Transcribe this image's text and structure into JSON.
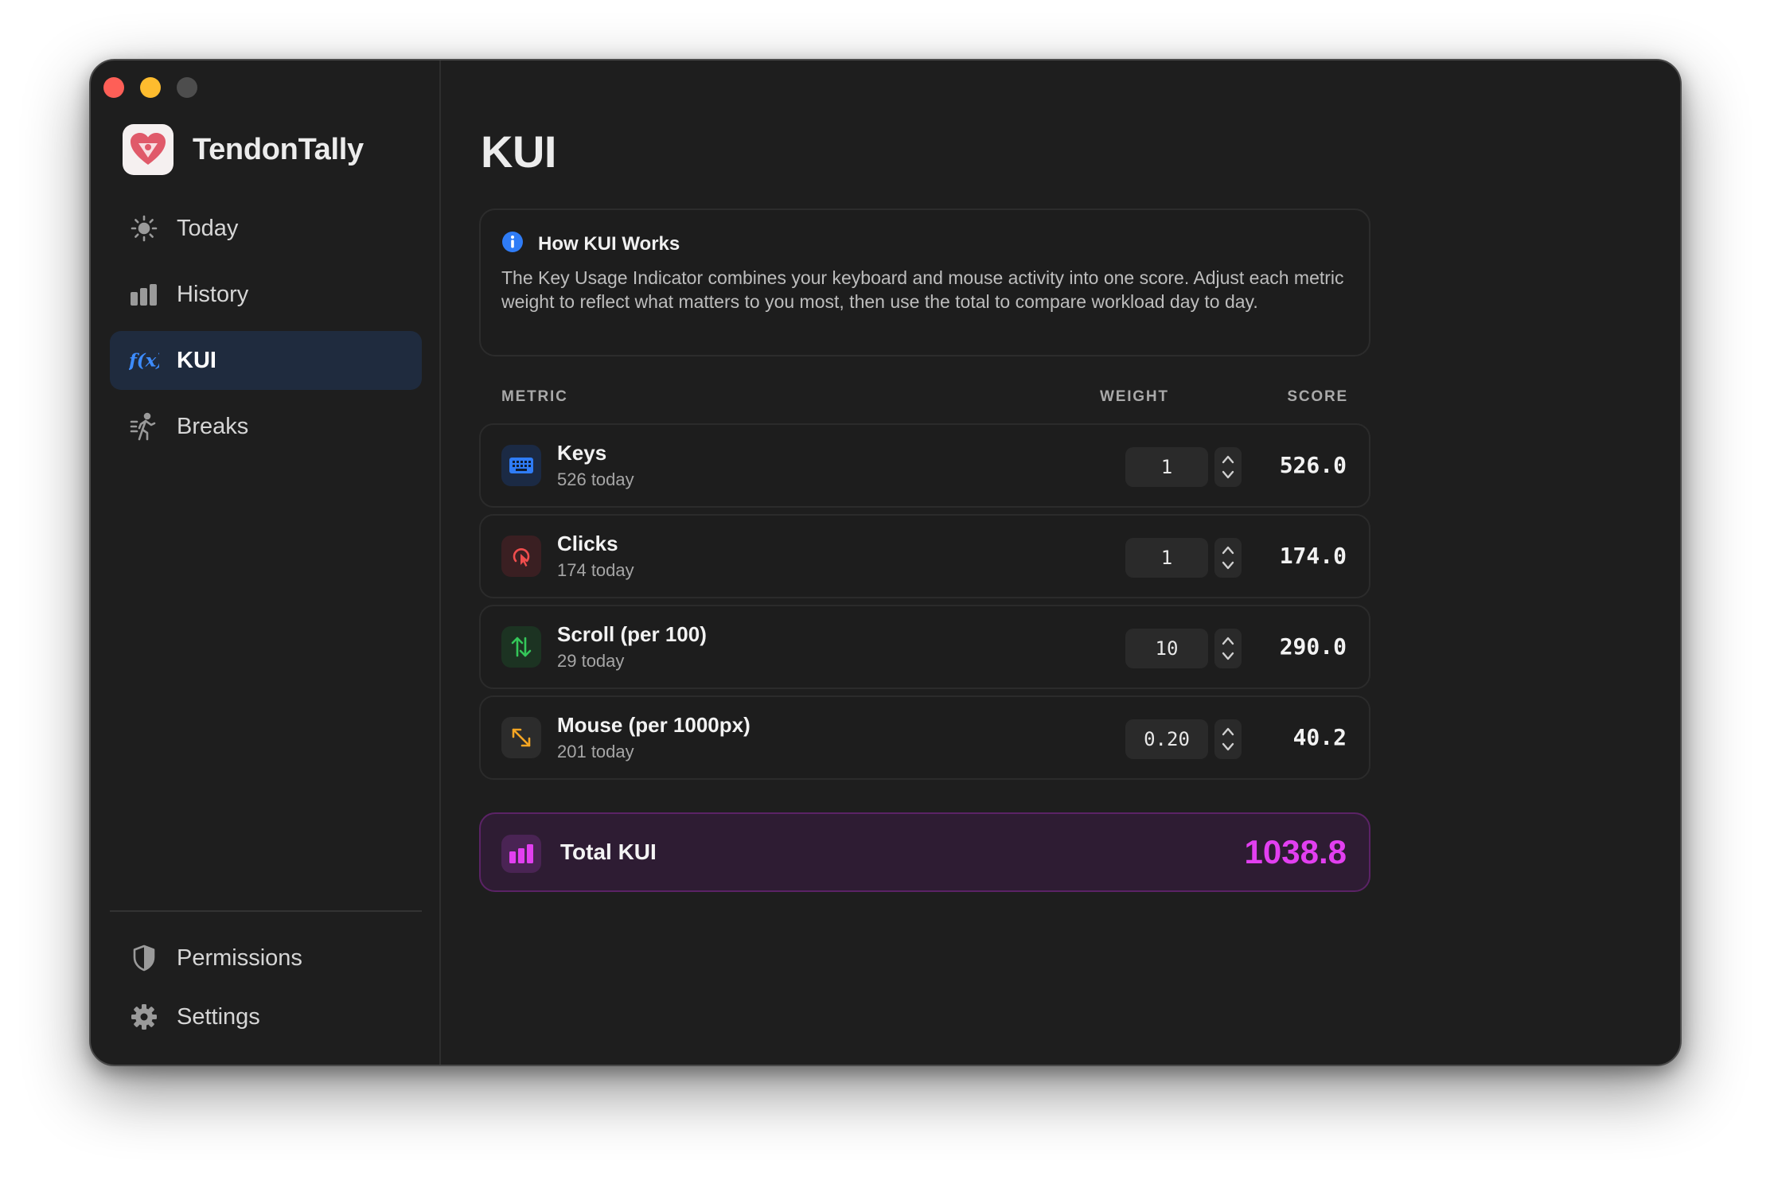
{
  "app": {
    "name": "TendonTally"
  },
  "sidebar": {
    "items": [
      {
        "label": "Today",
        "icon": "sun-icon",
        "active": false
      },
      {
        "label": "History",
        "icon": "bar-chart-icon",
        "active": false
      },
      {
        "label": "KUI",
        "icon": "function-icon",
        "active": true
      },
      {
        "label": "Breaks",
        "icon": "walking-figure-icon",
        "active": false
      }
    ],
    "bottom_items": [
      {
        "label": "Permissions",
        "icon": "shield-icon"
      },
      {
        "label": "Settings",
        "icon": "gear-icon"
      }
    ]
  },
  "main": {
    "title": "KUI",
    "info": {
      "heading": "How KUI Works",
      "body": "The Key Usage Indicator combines your keyboard and mouse activity into one score. Adjust each metric weight to reflect what matters to you most, then use the total to compare workload day to day."
    },
    "table": {
      "headers": {
        "metric": "METRIC",
        "weight": "WEIGHT",
        "score": "SCORE"
      },
      "rows": [
        {
          "name": "Keys",
          "subtitle": "526 today",
          "weight": "1",
          "score": "526.0",
          "icon": "keyboard-icon",
          "color": "#2f7cf6"
        },
        {
          "name": "Clicks",
          "subtitle": "174 today",
          "weight": "1",
          "score": "174.0",
          "icon": "cursor-click-icon",
          "color": "#ef4d4d"
        },
        {
          "name": "Scroll (per 100)",
          "subtitle": "29 today",
          "weight": "10",
          "score": "290.0",
          "icon": "scroll-arrows-icon",
          "color": "#34c759"
        },
        {
          "name": "Mouse (per 1000px)",
          "subtitle": "201 today",
          "weight": "0.20",
          "score": "40.2",
          "icon": "diagonal-arrows-icon",
          "color": "#f5a623"
        }
      ]
    },
    "total": {
      "label": "Total KUI",
      "value": "1038.8",
      "color": "#e23ff0"
    }
  }
}
